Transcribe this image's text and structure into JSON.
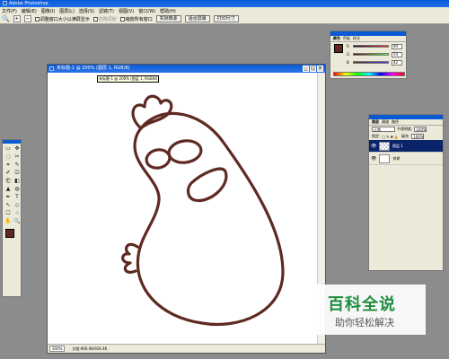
{
  "app": {
    "title": "Adobe Photoshop"
  },
  "menu": [
    "文件(F)",
    "编辑(E)",
    "图像(I)",
    "图层(L)",
    "选择(S)",
    "滤镜(T)",
    "视图(V)",
    "窗口(W)",
    "帮助(H)"
  ],
  "options": {
    "zoom_in": "+",
    "zoom_out": "−",
    "resize_window": "调整窗口大小以满屏显示",
    "ignore_palettes": "忽略调板",
    "zoom_all": "缩放所有窗口",
    "actual_pixels": "实际像素",
    "fit_screen": "适合屏幕",
    "print_size": "打印尺寸"
  },
  "document": {
    "title": "未标题-1 @ 200% (图层 1, RGB/8)",
    "tooltip": "未标题-1 @ 200% (图层 1, RGB/8)",
    "zoom": "200%",
    "doc_info": "文档:900.0K/916.4K",
    "stroke_color": "#5e2a22"
  },
  "color_panel": {
    "tabs": [
      "颜色",
      "色板",
      "样式"
    ],
    "rows": [
      {
        "label": "R",
        "value": "94"
      },
      {
        "label": "G",
        "value": "54"
      },
      {
        "label": "B",
        "value": "42"
      }
    ],
    "foreground": "#5e2a22"
  },
  "layers_panel": {
    "tabs": [
      "图层",
      "通道",
      "路径"
    ],
    "blend_mode": "正常",
    "opacity_label": "不透明度:",
    "opacity": "100%",
    "lock_label": "锁定:",
    "fill_label": "填充:",
    "fill": "100%",
    "layers": [
      {
        "name": "图层 1",
        "active": true
      },
      {
        "name": "背景",
        "active": false
      }
    ]
  },
  "tools_panel": {
    "icons": [
      "▭",
      "✥",
      "◌",
      "✂",
      "⌗",
      "✎",
      "✐",
      "⎚",
      "⎗",
      "◧",
      "▲",
      "◍",
      "✒",
      "T",
      "↖",
      "◇",
      "☐",
      "☝",
      "✋",
      "🔍"
    ]
  },
  "watermark": {
    "title": "百科全说",
    "subtitle": "助你轻松解决"
  }
}
